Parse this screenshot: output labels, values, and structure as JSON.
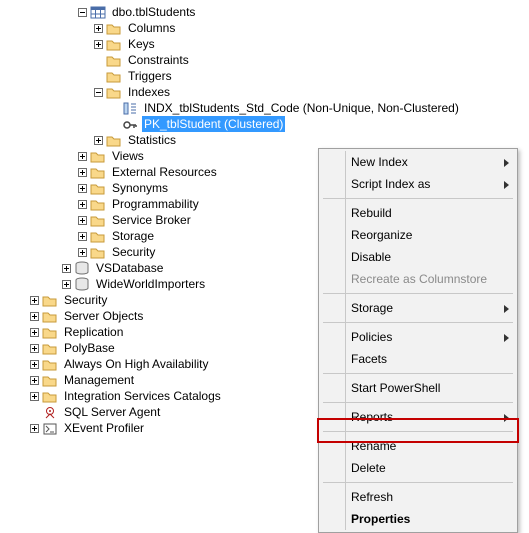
{
  "tree": {
    "table_name": "dbo.tblStudents",
    "columns": "Columns",
    "keys": "Keys",
    "constraints": "Constraints",
    "triggers": "Triggers",
    "indexes": "Indexes",
    "index_nonunique": "INDX_tblStudents_Std_Code (Non-Unique, Non-Clustered)",
    "index_pk": "PK_tblStudent (Clustered)",
    "statistics": "Statistics",
    "views": "Views",
    "external_resources": "External Resources",
    "synonyms": "Synonyms",
    "programmability": "Programmability",
    "service_broker": "Service Broker",
    "storage": "Storage",
    "security_inner": "Security",
    "vsdatabase": "VSDatabase",
    "wideworld": "WideWorldImporters",
    "security": "Security",
    "server_objects": "Server Objects",
    "replication": "Replication",
    "polybase": "PolyBase",
    "always_on": "Always On High Availability",
    "management": "Management",
    "integration_services": "Integration Services Catalogs",
    "sql_server_agent": "SQL Server Agent",
    "xevent_profiler": "XEvent Profiler"
  },
  "menu": {
    "new_index": "New Index",
    "script_index": "Script Index as",
    "rebuild": "Rebuild",
    "reorganize": "Reorganize",
    "disable": "Disable",
    "recreate_cs": "Recreate as Columnstore",
    "storage": "Storage",
    "policies": "Policies",
    "facets": "Facets",
    "start_ps": "Start PowerShell",
    "reports": "Reports",
    "rename": "Rename",
    "delete": "Delete",
    "refresh": "Refresh",
    "properties": "Properties"
  }
}
